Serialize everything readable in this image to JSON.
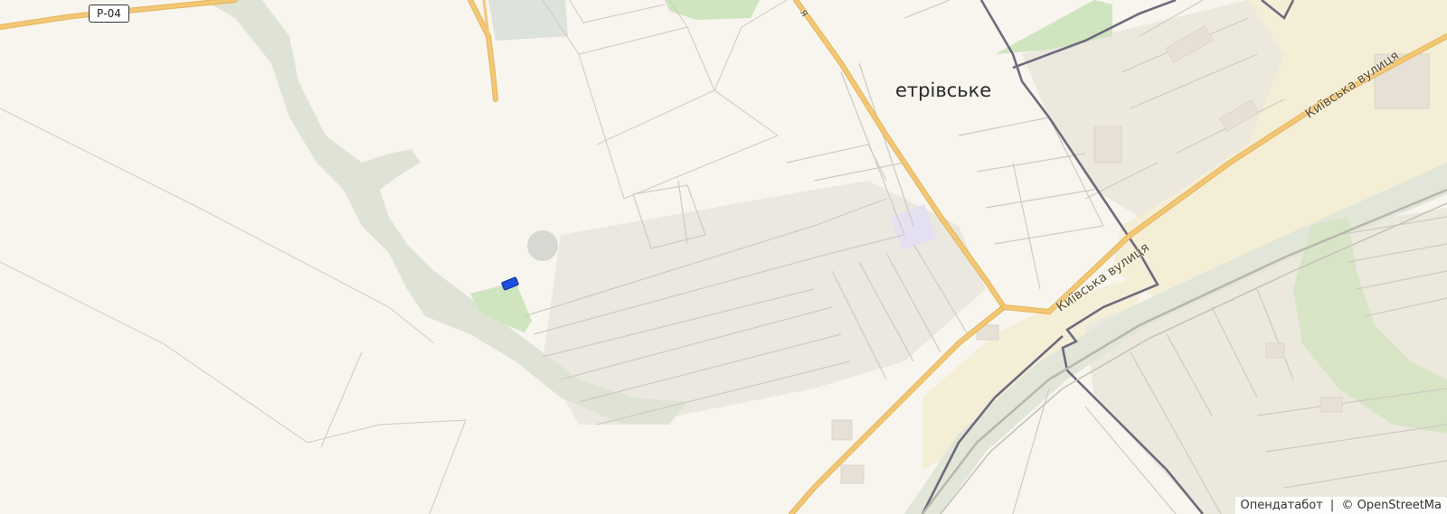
{
  "map": {
    "road_shield": "Р-04",
    "place_label": "етрівське",
    "street_labels": [
      "Київська вулиця",
      "Київська вулиця",
      "я"
    ],
    "attribution": {
      "provider": "Опендатабот",
      "separator": "|",
      "copyright": "© OpenStreetMa"
    }
  },
  "colors": {
    "background": "#f7f5ee",
    "major_road": "#f3c774",
    "major_road_casing": "#e3b45a",
    "minor_road": "#cfcac1",
    "boundary": "#6e6b7d",
    "river_valley": "#dfe3d5",
    "park": "#cfe5bf",
    "industrial": "#f4eed6",
    "residential_block": "#ebe8df",
    "marker": "#1f4fe0"
  },
  "icons": [
    "map-marker-icon"
  ]
}
